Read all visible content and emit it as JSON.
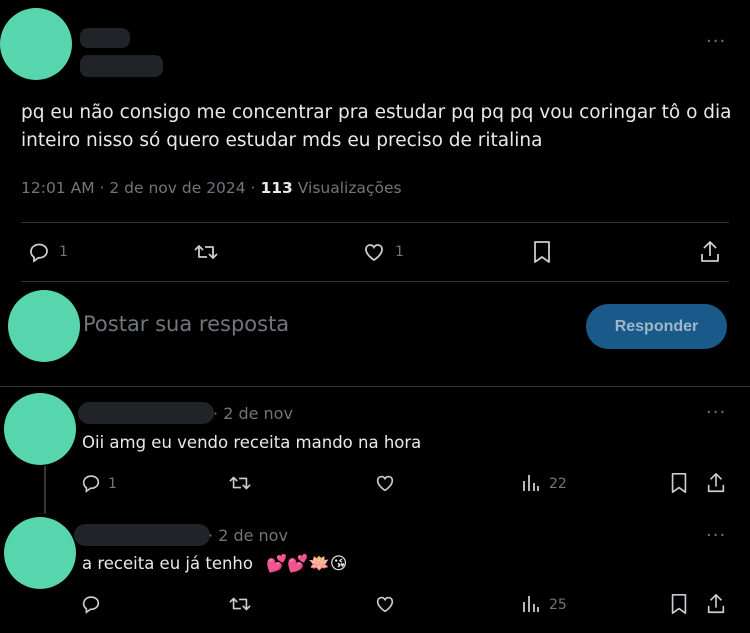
{
  "main_post": {
    "text": "pq eu não consigo me concentrar pra estudar pq pq pq vou coringar tô o dia inteiro nisso só quero estudar mds eu preciso de ritalina",
    "time": "12:01 AM",
    "date": "2 de nov de 2024",
    "views_count": "113",
    "views_label": "Visualizações",
    "reply_count": "1",
    "like_count": "1"
  },
  "composer": {
    "placeholder": "Postar sua resposta",
    "button_label": "Responder"
  },
  "replies": [
    {
      "date": "2 de nov",
      "text": "Oii amg eu vendo receita mando na hora",
      "reply_count": "1",
      "views": "22"
    },
    {
      "date": "2 de nov",
      "text": "a receita eu já tenho",
      "emoji": "💕💕🪷😘",
      "views": "25"
    }
  ],
  "separator": "·",
  "more_glyph": "···",
  "colors": {
    "background": "#000000",
    "text": "#e7e9ea",
    "muted": "#71767b",
    "avatar": "#57d6ae",
    "button": "#1a5a8a",
    "divider": "#2f3336"
  },
  "icons": [
    "reply-icon",
    "retweet-icon",
    "like-icon",
    "bookmark-icon",
    "share-icon",
    "views-icon",
    "more-icon"
  ]
}
